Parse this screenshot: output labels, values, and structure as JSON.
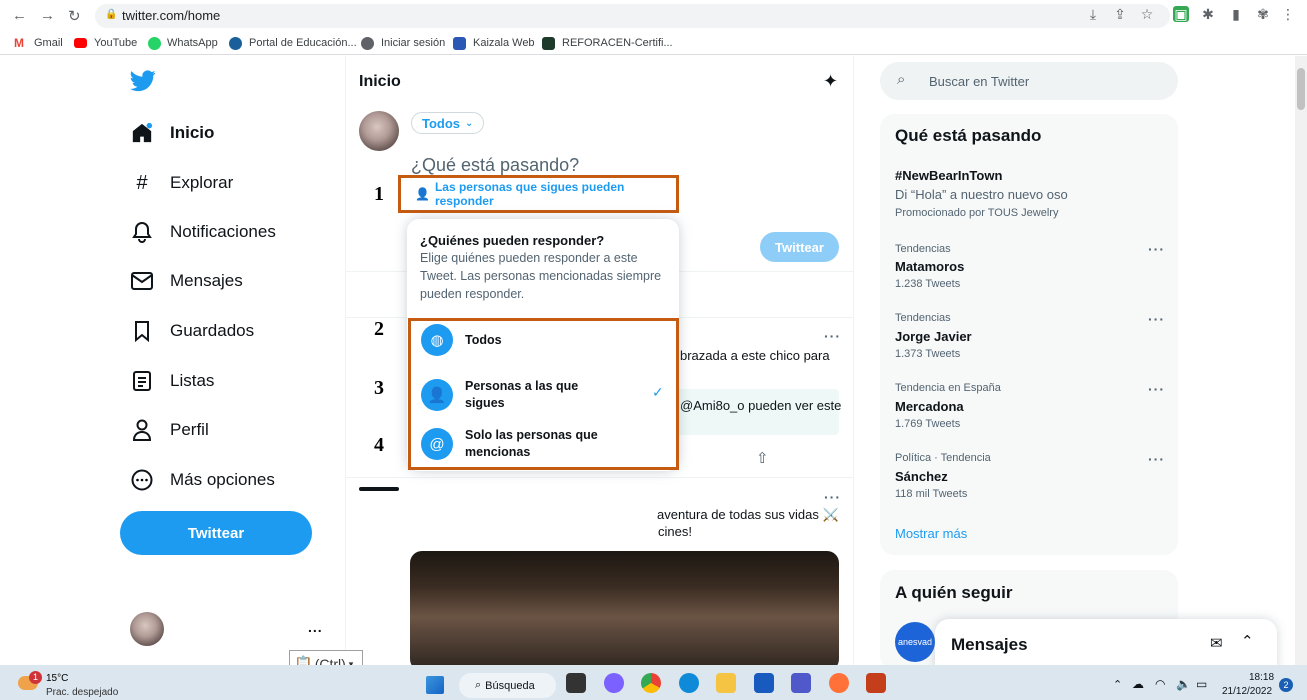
{
  "browser": {
    "url": "twitter.com/home",
    "bookmarks": [
      "Gmail",
      "YouTube",
      "WhatsApp",
      "Portal de Educación...",
      "Iniciar sesión",
      "Kaizala Web",
      "REFORACEN-Certifi..."
    ]
  },
  "sidebar": {
    "items": [
      {
        "label": "Inicio",
        "icon": "home-icon"
      },
      {
        "label": "Explorar",
        "icon": "hashtag-icon"
      },
      {
        "label": "Notificaciones",
        "icon": "bell-icon"
      },
      {
        "label": "Mensajes",
        "icon": "envelope-icon"
      },
      {
        "label": "Guardados",
        "icon": "bookmark-icon"
      },
      {
        "label": "Listas",
        "icon": "list-icon"
      },
      {
        "label": "Perfil",
        "icon": "person-icon"
      },
      {
        "label": "Más opciones",
        "icon": "more-circle-icon"
      }
    ],
    "tweet_button": "Twittear",
    "more": "..."
  },
  "main": {
    "title": "Inicio",
    "audience": "Todos",
    "placeholder": "¿Qué está pasando?",
    "reply_setting": "Las personas que sigues pueden responder",
    "tweet_button": "Twittear",
    "feed": [
      "brazada a este chico para",
      "@Ami8o_o pueden ver este",
      "aventura de todas sus vidas ⚔️",
      "cines!"
    ]
  },
  "annotations": [
    "1",
    "2",
    "3",
    "4"
  ],
  "popup": {
    "title": "¿Quiénes pueden responder?",
    "description": "Elige quiénes pueden responder a este Tweet. Las personas mencionadas siempre pueden responder.",
    "options": [
      {
        "label": "Todos",
        "icon": "globe-icon"
      },
      {
        "label": "Personas a las que sigues",
        "icon": "person-check-icon",
        "selected": true
      },
      {
        "label": "Solo las personas que mencionas",
        "icon": "at-icon"
      }
    ]
  },
  "right": {
    "search_placeholder": "Buscar en Twitter",
    "trends_title": "Qué está pasando",
    "promo": {
      "tag": "#NewBearInTown",
      "text": "Di “Hola” a nuestro nuevo oso",
      "by": "Promocionado por TOUS Jewelry"
    },
    "trends": [
      {
        "context": "Tendencias",
        "name": "Matamoros",
        "count": "1.238 Tweets"
      },
      {
        "context": "Tendencias",
        "name": "Jorge Javier",
        "count": "1.373 Tweets"
      },
      {
        "context": "Tendencia en España",
        "name": "Mercadona",
        "count": "1.769 Tweets"
      },
      {
        "context": "Política · Tendencia",
        "name": "Sánchez",
        "count": "118 mil Tweets"
      }
    ],
    "show_more": "Mostrar más",
    "follow_title": "A quién seguir",
    "follow_avatar": "anesvad"
  },
  "messages_dock": {
    "title": "Mensajes"
  },
  "clipboard": "(Ctrl)",
  "taskbar": {
    "weather": "15°C",
    "weather_desc": "Prac. despejado",
    "weather_badge": "1",
    "search": "Búsqueda",
    "time": "18:18",
    "date": "21/12/2022",
    "notif": "2"
  }
}
